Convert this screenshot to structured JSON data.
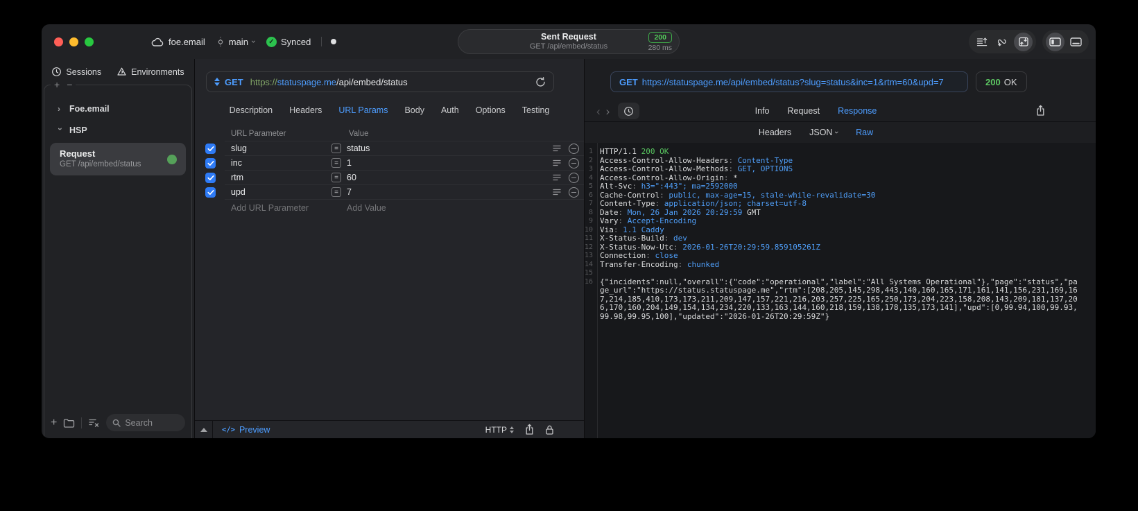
{
  "titlebar": {
    "project": "foe.email",
    "branch": "main",
    "sync": "Synced",
    "request_title": "Sent Request",
    "request_subtitle": "GET /api/embed/status",
    "status_code": "200",
    "duration": "280 ms"
  },
  "sidebar": {
    "tabs": [
      "Sessions",
      "Environments"
    ],
    "groups": [
      {
        "label": "Foe.email",
        "state": "collapsed"
      },
      {
        "label": "HSP",
        "state": "expanded"
      }
    ],
    "request": {
      "title": "Request",
      "subtitle": "GET /api/embed/status"
    },
    "search_placeholder": "Search"
  },
  "request_editor": {
    "method": "GET",
    "url": {
      "scheme": "https://",
      "host": "statuspage.me",
      "path": "/api/embed/status"
    },
    "tabs": [
      "Description",
      "Headers",
      "URL Params",
      "Body",
      "Auth",
      "Options",
      "Testing"
    ],
    "active_tab": "URL Params",
    "params": {
      "col_name": "URL Parameter",
      "col_value": "Value",
      "rows": [
        {
          "checked": true,
          "name": "slug",
          "op": "=",
          "value": "status"
        },
        {
          "checked": true,
          "name": "inc",
          "op": "=",
          "value": "1"
        },
        {
          "checked": true,
          "name": "rtm",
          "op": "=",
          "value": "60"
        },
        {
          "checked": true,
          "name": "upd",
          "op": "=",
          "value": "7"
        }
      ],
      "add_name": "Add URL Parameter",
      "add_value": "Add Value"
    },
    "footer": {
      "preview_glyph": "</>",
      "preview": "Preview",
      "protocol": "HTTP"
    }
  },
  "response_viewer": {
    "method": "GET",
    "request_url": "https://statuspage.me/api/embed/status?slug=status&inc=1&rtm=60&upd=7",
    "status_code": "200",
    "status_text": "OK",
    "tabs": [
      "Info",
      "Request",
      "Response"
    ],
    "active_tab": "Response",
    "subtabs": [
      "Headers",
      "JSON",
      "Raw"
    ],
    "active_subtab": "Raw",
    "status_line": {
      "protocol": "HTTP/1.1",
      "status": "200 OK"
    },
    "headers": [
      {
        "name": "Access-Control-Allow-Headers",
        "value": "Content-Type"
      },
      {
        "name": "Access-Control-Allow-Methods",
        "value": "GET, OPTIONS"
      },
      {
        "name": "Access-Control-Allow-Origin",
        "value": "*",
        "plain": true
      },
      {
        "name": "Alt-Svc",
        "value": "h3=\":443\"; ma=2592000"
      },
      {
        "name": "Cache-Control",
        "value": "public, max-age=15, stale-while-revalidate=30"
      },
      {
        "name": "Content-Type",
        "value": "application/json; charset=utf-8"
      },
      {
        "name": "Date",
        "value": "Mon, 26 Jan 2026 20:29:59",
        "suffix": " GMT"
      },
      {
        "name": "Vary",
        "value": "Accept-Encoding"
      },
      {
        "name": "Via",
        "value": "1.1 Caddy"
      },
      {
        "name": "X-Status-Build",
        "value": "dev"
      },
      {
        "name": "X-Status-Now-Utc",
        "value": "2026-01-26T20:29:59.859105261Z"
      },
      {
        "name": "Connection",
        "value": "close"
      },
      {
        "name": "Transfer-Encoding",
        "value": "chunked"
      }
    ],
    "body": "{\"incidents\":null,\"overall\":{\"code\":\"operational\",\"label\":\"All Systems Operational\"},\"page\":\"status\",\"page_url\":\"https://status.statuspage.me\",\"rtm\":[208,205,145,298,443,140,160,165,171,161,141,156,231,169,167,214,185,410,173,173,211,209,147,157,221,216,203,257,225,165,250,173,204,223,158,208,143,209,181,137,206,170,160,204,149,154,134,234,220,133,163,144,160,218,159,138,178,135,173,141],\"upd\":[0,99.94,100,99.93,99.98,99.95,100],\"updated\":\"2026-01-26T20:29:59Z\"}"
  },
  "colors": {
    "accent_blue": "#4d9dff",
    "status_green": "#53c95a",
    "checkbox_blue": "#2e7bf6"
  }
}
